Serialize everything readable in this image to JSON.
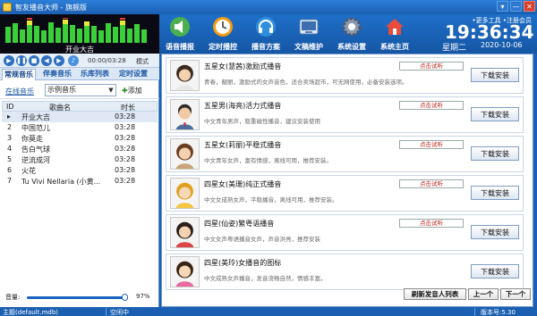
{
  "window": {
    "title": "智友播音大师 - 旗舰版",
    "buttons": [
      "▾",
      "—",
      "✕"
    ]
  },
  "player": {
    "song_title": "开业大吉",
    "time": "00:00/03:28",
    "mode_label": "模式"
  },
  "toolbar": [
    {
      "label": "语音播报",
      "icon": "speaker-icon"
    },
    {
      "label": "定时播控",
      "icon": "clock-icon"
    },
    {
      "label": "播音方案",
      "icon": "headset-icon"
    },
    {
      "label": "文稿维护",
      "icon": "document-icon"
    },
    {
      "label": "系统设置",
      "icon": "gear-icon"
    },
    {
      "label": "系统主页",
      "icon": "home-icon"
    }
  ],
  "clock": {
    "links": "•更多工具  •注册会员",
    "time": "19:36:34",
    "weekday": "星期二",
    "date": "2020-10-06"
  },
  "tabs": [
    "常规音乐",
    "伴奏音乐",
    "乐库列表",
    "定时设置"
  ],
  "list_controls": {
    "online_music": "在线音乐",
    "category": "示例音乐",
    "add": "添加"
  },
  "song_table": {
    "headers": [
      "ID",
      "歌曲名",
      "时长"
    ],
    "rows": [
      {
        "id": "▸",
        "name": "开业大吉",
        "duration": "03:28"
      },
      {
        "id": "2",
        "name": "中国范儿",
        "duration": "03:28"
      },
      {
        "id": "3",
        "name": "你莫走",
        "duration": "03:28"
      },
      {
        "id": "4",
        "name": "告白气球",
        "duration": "03:28"
      },
      {
        "id": "5",
        "name": "逆流成河",
        "duration": "03:28"
      },
      {
        "id": "6",
        "name": "火花",
        "duration": "03:28"
      },
      {
        "id": "7",
        "name": "Tu Vivi Nellaria (小黄...",
        "duration": "03:28"
      }
    ]
  },
  "volume": {
    "label": "音量:",
    "percent": "97%",
    "level": 0.97
  },
  "announcers": [
    {
      "name": "五星女(慧茜)激励式播音",
      "desc": "青春，靓丽，激励式的女声音色，适合卖场超市，可无网使用，必备安装选项。",
      "preview": "点击试听",
      "download": "下载安装"
    },
    {
      "name": "五星男(海亮)活力式播音",
      "desc": "中文青年男声，稳重磁性播音，建议安装使用",
      "preview": "点击试听",
      "download": "下载安装"
    },
    {
      "name": "五星女(莉丽)平稳式播音",
      "desc": "中文青年女声，富有情感，离线可用，推荐安装。",
      "preview": "点击试听",
      "download": "下载安装"
    },
    {
      "name": "四星女(美珊)纯正式播音",
      "desc": "中文女成熟女声，平稳播音，离线可用，推荐安装。",
      "preview": "点击试听",
      "download": "下载安装"
    },
    {
      "name": "四星(仙姿)繁粤语播音",
      "desc": "中文女声粤语播音女声，声音洪亮，推荐安装",
      "preview": "点击试听",
      "download": "下载安装"
    },
    {
      "name": "四星(美玲)女播音的图标",
      "desc": "中文成熟女声播音，发音流畅自然，情感丰富。",
      "preview": "点击试听",
      "download": "下载安装"
    }
  ],
  "pager": {
    "refresh": "刷新发音人列表",
    "prev": "上一个",
    "next": "下一个"
  },
  "status": {
    "db": "主题(default.mdb)",
    "state": "空闲中",
    "version": "版本号:5.30"
  }
}
